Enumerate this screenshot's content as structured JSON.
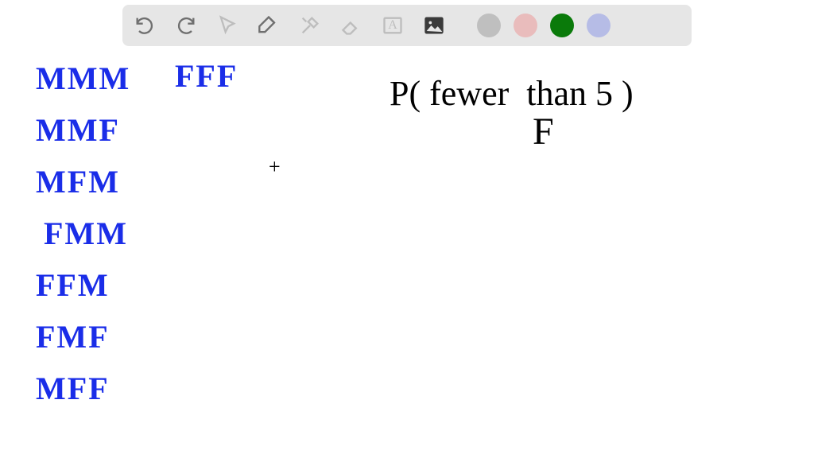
{
  "toolbar": {
    "items": [
      {
        "name": "undo-icon"
      },
      {
        "name": "redo-icon"
      },
      {
        "name": "pointer-icon"
      },
      {
        "name": "pen-icon"
      },
      {
        "name": "tools-icon"
      },
      {
        "name": "eraser-icon"
      },
      {
        "name": "textbox-icon"
      },
      {
        "name": "image-icon"
      }
    ],
    "text_a": "A",
    "colors": {
      "gray": "#bfbfbf",
      "pink": "#e9bcbc",
      "green": "#0a7a0a",
      "lilac": "#b6bce6"
    }
  },
  "column1": [
    "MMM",
    "MMF",
    "MFM",
    "FMM",
    "FFM",
    "FMF",
    "MFF"
  ],
  "column2": [
    "FFF"
  ],
  "formula": {
    "line1": "P( fewer  than 5 )",
    "line2": "F"
  }
}
